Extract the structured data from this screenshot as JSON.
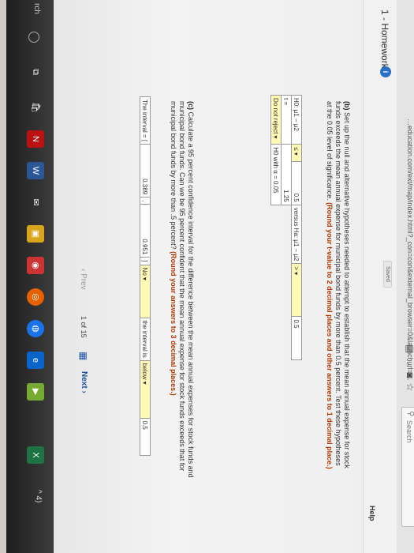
{
  "browser": {
    "url": "…education.com/ext/map/index.html?_con=con&external_browser=0&launchurl=…",
    "search_placeholder": "Search",
    "icons": [
      "reader-icon",
      "more-icon",
      "pocket-icon",
      "bookmark-star-icon"
    ]
  },
  "assignment": {
    "title": "1 - Homework",
    "badge": "i",
    "saved_label": "Saved",
    "help_label": "Help"
  },
  "part_b": {
    "prefix": "(b)",
    "text": "Set up the null and alternative hypotheses needed to attempt to establish that the mean annual expense for stock funds exceeds the mean annual expense for municipal bond funds by more than 0.5 percent. Test these hypotheses at the 0.05 level of significance.",
    "note": "(Round your t-value to 2 decimal places and other answers to 1 decimal place.)",
    "row1": {
      "label": "H0: μ1 − μ2",
      "sign": "≤",
      "value": "0.5",
      "versus": "versus Ha: μ1 − μ2",
      "sign2": ">",
      "value2": "0.5"
    },
    "row2": {
      "label": "t =",
      "value": "1.25"
    },
    "row3": {
      "decision": "Do not reject",
      "condition": "H0 with α = 0.05"
    }
  },
  "part_c": {
    "prefix": "(c)",
    "text": "Calculate a 95 percent confidence interval for the difference between the mean annual expenses for stock funds and municipal bond funds. Can we be 95 percent confident that the mean annual expense for stock funds exceeds that for municipal bond funds by more than .5 percent?",
    "note": "(Round your answers to 3 decimal places.)",
    "interval_label": "The interval = [",
    "lower": "0.389",
    "comma": ",",
    "upper": "0.951",
    "close": "]",
    "answer": "No",
    "interval_is": "the interval is",
    "position": "below",
    "compare": "0.5"
  },
  "navigation": {
    "prev_label": "Prev",
    "page_current": "1",
    "page_of": "of",
    "page_total": "15",
    "next_label": "Next"
  },
  "taskbar": {
    "search_fragment": "rch",
    "apps": [
      "task-view-icon",
      "store-icon",
      "netflix-icon",
      "word-icon",
      "mail-icon",
      "explorer-icon",
      "photos-icon",
      "firefox-icon",
      "chrome-icon",
      "edge-icon",
      "media-icon",
      "excel-icon"
    ],
    "tray": "^ 4)"
  }
}
